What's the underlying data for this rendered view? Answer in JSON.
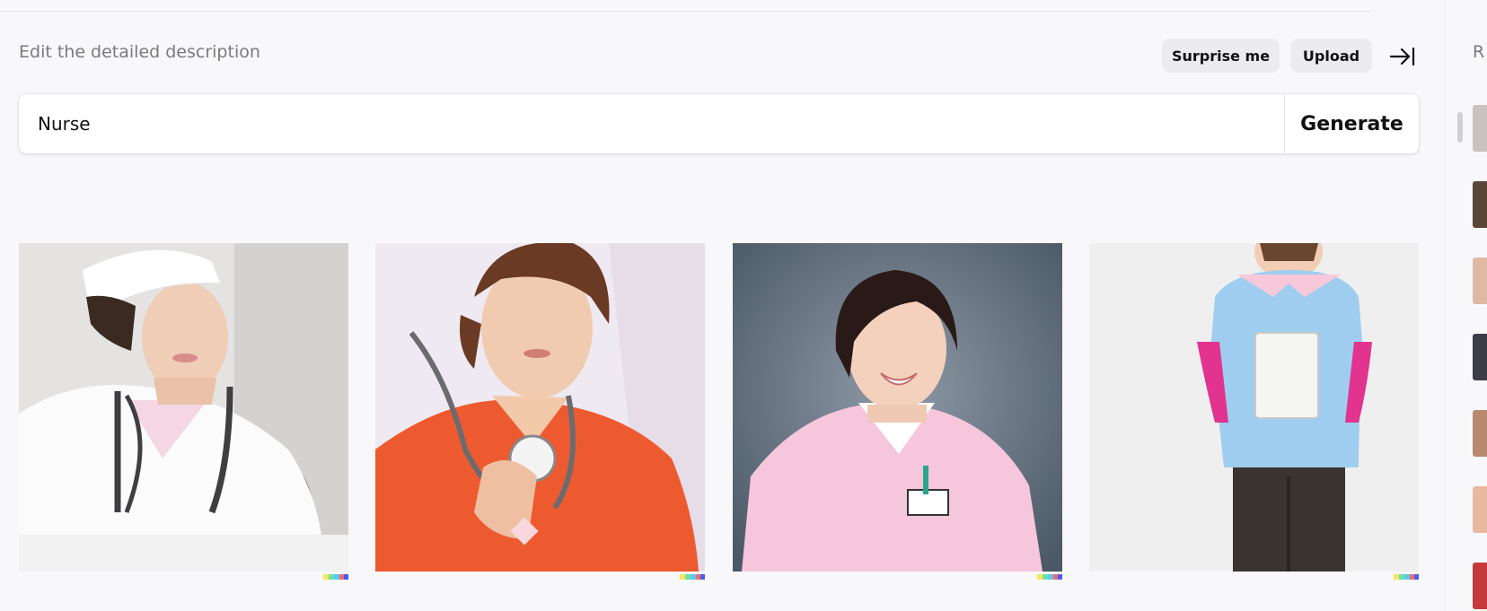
{
  "header": {
    "title": "Edit the detailed description",
    "surprise_label": "Surprise me",
    "upload_label": "Upload",
    "collapse_icon": "arrow-right-to-bar-icon"
  },
  "prompt": {
    "value": "Nurse",
    "generate_label": "Generate"
  },
  "results": [
    {
      "label": "nurse in white uniform and cap with stethoscope"
    },
    {
      "label": "nurse in red scrubs holding stethoscope"
    },
    {
      "label": "smiling nurse in pink uniform"
    },
    {
      "label": "nurse in blue tunic holding clipboard"
    }
  ],
  "sidebar": {
    "title_initial": "R"
  },
  "colors": {
    "accent_watermark": [
      "#f7e65b",
      "#6ee0a8",
      "#5bc8f2",
      "#f06c6c",
      "#4b5cf0"
    ]
  }
}
